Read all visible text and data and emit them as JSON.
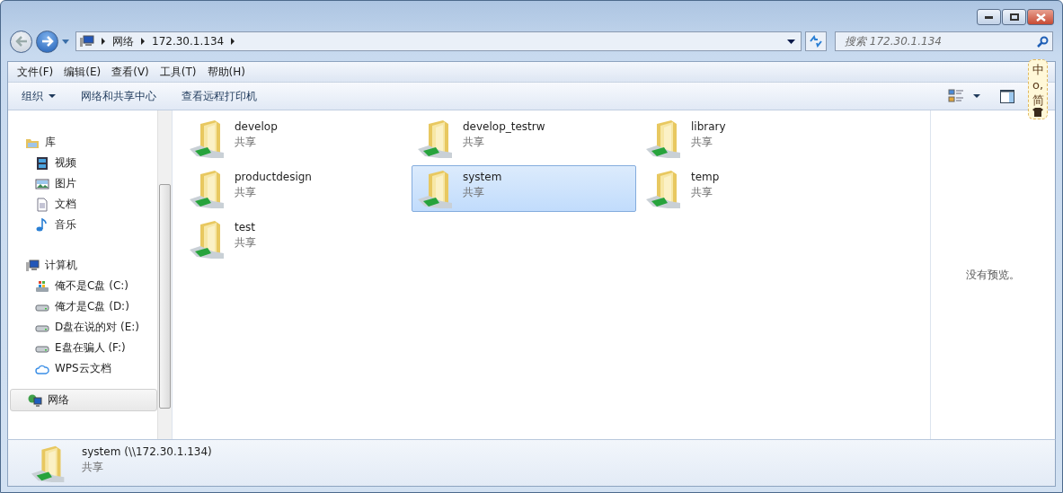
{
  "address": {
    "breadcrumbs": [
      "网络",
      "172.30.1.134"
    ]
  },
  "search": {
    "placeholder": "搜索 172.30.1.134"
  },
  "menu": [
    "文件(F)",
    "编辑(E)",
    "查看(V)",
    "工具(T)",
    "帮助(H)"
  ],
  "commands": [
    {
      "label": "组织",
      "dropdown": true
    },
    {
      "label": "网络和共享中心",
      "dropdown": false
    },
    {
      "label": "查看远程打印机",
      "dropdown": false
    }
  ],
  "ime": [
    "中",
    "o,",
    "简"
  ],
  "sidebar": [
    {
      "label": "库",
      "kind": "library",
      "selected": false,
      "children": [
        {
          "label": "视频",
          "kind": "video",
          "selected": false
        },
        {
          "label": "图片",
          "kind": "pictures",
          "selected": false
        },
        {
          "label": "文档",
          "kind": "documents",
          "selected": false
        },
        {
          "label": "音乐",
          "kind": "music",
          "selected": false
        }
      ]
    },
    {
      "label": "计算机",
      "kind": "computer",
      "selected": false,
      "children": [
        {
          "label": "俺不是C盘 (C:)",
          "kind": "system-drive",
          "selected": false
        },
        {
          "label": "俺才是C盘 (D:)",
          "kind": "drive",
          "selected": false
        },
        {
          "label": "D盘在说的对 (E:)",
          "kind": "drive",
          "selected": false
        },
        {
          "label": "E盘在骗人 (F:)",
          "kind": "drive",
          "selected": false
        },
        {
          "label": "WPS云文档",
          "kind": "cloud",
          "selected": false
        }
      ]
    },
    {
      "label": "网络",
      "kind": "network",
      "selected": true
    }
  ],
  "files": [
    {
      "name": "develop",
      "type": "共享",
      "selected": false
    },
    {
      "name": "develop_testrw",
      "type": "共享",
      "selected": false
    },
    {
      "name": "library",
      "type": "共享",
      "selected": false
    },
    {
      "name": "productdesign",
      "type": "共享",
      "selected": false
    },
    {
      "name": "system",
      "type": "共享",
      "selected": true
    },
    {
      "name": "temp",
      "type": "共享",
      "selected": false
    },
    {
      "name": "test",
      "type": "共享",
      "selected": false
    }
  ],
  "preview": {
    "message": "没有预览。"
  },
  "details": {
    "title": "system (\\\\172.30.1.134)",
    "subtitle": "共享"
  }
}
